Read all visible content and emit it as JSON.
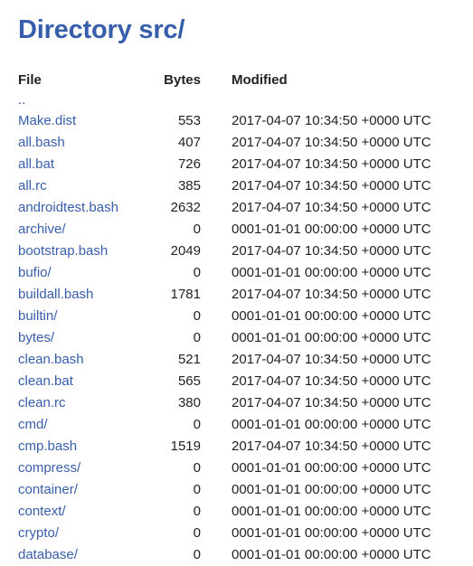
{
  "page": {
    "title": "Directory src/"
  },
  "table": {
    "headers": {
      "file": "File",
      "bytes": "Bytes",
      "modified": "Modified"
    },
    "parent_link": "..",
    "rows": [
      {
        "name": "Make.dist",
        "bytes": "553",
        "modified": "2017-04-07 10:34:50 +0000 UTC"
      },
      {
        "name": "all.bash",
        "bytes": "407",
        "modified": "2017-04-07 10:34:50 +0000 UTC"
      },
      {
        "name": "all.bat",
        "bytes": "726",
        "modified": "2017-04-07 10:34:50 +0000 UTC"
      },
      {
        "name": "all.rc",
        "bytes": "385",
        "modified": "2017-04-07 10:34:50 +0000 UTC"
      },
      {
        "name": "androidtest.bash",
        "bytes": "2632",
        "modified": "2017-04-07 10:34:50 +0000 UTC"
      },
      {
        "name": "archive/",
        "bytes": "0",
        "modified": "0001-01-01 00:00:00 +0000 UTC"
      },
      {
        "name": "bootstrap.bash",
        "bytes": "2049",
        "modified": "2017-04-07 10:34:50 +0000 UTC"
      },
      {
        "name": "bufio/",
        "bytes": "0",
        "modified": "0001-01-01 00:00:00 +0000 UTC"
      },
      {
        "name": "buildall.bash",
        "bytes": "1781",
        "modified": "2017-04-07 10:34:50 +0000 UTC"
      },
      {
        "name": "builtin/",
        "bytes": "0",
        "modified": "0001-01-01 00:00:00 +0000 UTC"
      },
      {
        "name": "bytes/",
        "bytes": "0",
        "modified": "0001-01-01 00:00:00 +0000 UTC"
      },
      {
        "name": "clean.bash",
        "bytes": "521",
        "modified": "2017-04-07 10:34:50 +0000 UTC"
      },
      {
        "name": "clean.bat",
        "bytes": "565",
        "modified": "2017-04-07 10:34:50 +0000 UTC"
      },
      {
        "name": "clean.rc",
        "bytes": "380",
        "modified": "2017-04-07 10:34:50 +0000 UTC"
      },
      {
        "name": "cmd/",
        "bytes": "0",
        "modified": "0001-01-01 00:00:00 +0000 UTC"
      },
      {
        "name": "cmp.bash",
        "bytes": "1519",
        "modified": "2017-04-07 10:34:50 +0000 UTC"
      },
      {
        "name": "compress/",
        "bytes": "0",
        "modified": "0001-01-01 00:00:00 +0000 UTC"
      },
      {
        "name": "container/",
        "bytes": "0",
        "modified": "0001-01-01 00:00:00 +0000 UTC"
      },
      {
        "name": "context/",
        "bytes": "0",
        "modified": "0001-01-01 00:00:00 +0000 UTC"
      },
      {
        "name": "crypto/",
        "bytes": "0",
        "modified": "0001-01-01 00:00:00 +0000 UTC"
      },
      {
        "name": "database/",
        "bytes": "0",
        "modified": "0001-01-01 00:00:00 +0000 UTC"
      }
    ]
  },
  "colors": {
    "title": "#375eab",
    "link": "#375eab",
    "text": "#222222",
    "background": "#ffffff"
  }
}
